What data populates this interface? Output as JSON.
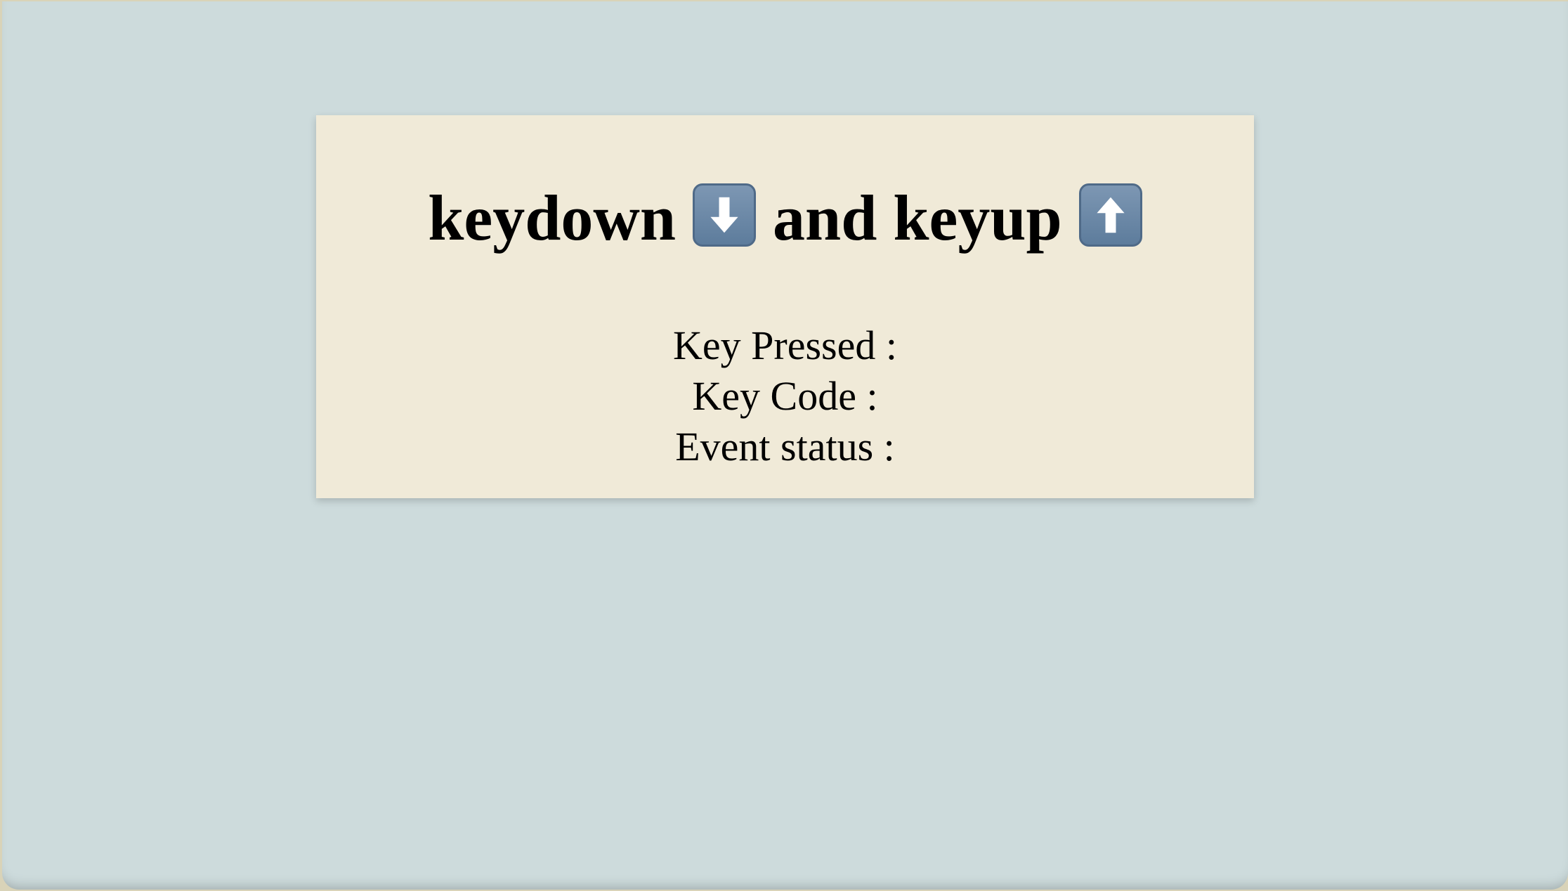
{
  "heading": {
    "part1": "keydown",
    "icon1": "down-arrow-key-icon",
    "part2": "and keyup",
    "icon2": "up-arrow-key-icon"
  },
  "info": {
    "key_pressed_label": "Key Pressed :",
    "key_pressed_value": "",
    "key_code_label": "Key Code :",
    "key_code_value": "",
    "event_status_label": "Event status :",
    "event_status_value": ""
  },
  "colors": {
    "page_background": "#cddbdc",
    "card_background": "#f0ead8",
    "icon_fill": "#6d89a8",
    "text": "#000000"
  }
}
